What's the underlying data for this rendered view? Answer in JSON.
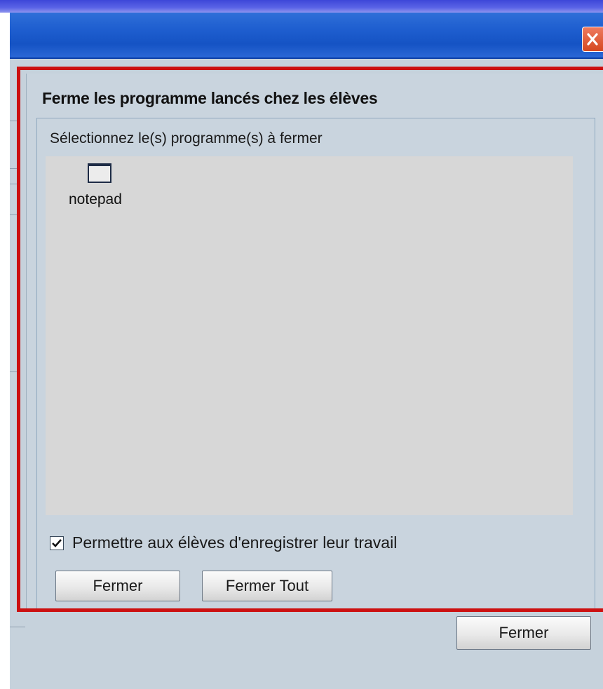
{
  "window": {
    "close_icon": "close-x-icon"
  },
  "panel": {
    "title": "Ferme les programme lancés chez les élèves",
    "group_label": "Sélectionnez le(s) programme(s) à fermer",
    "programs": [
      {
        "name": "notepad",
        "icon": "program-window-icon"
      }
    ],
    "allow_save_checkbox": {
      "label": "Permettre aux élèves d'enregistrer leur travail",
      "checked": true
    },
    "buttons": {
      "close_label": "Fermer",
      "close_all_label": "Fermer Tout"
    }
  },
  "footer": {
    "close_label": "Fermer"
  },
  "colors": {
    "highlight": "#cc1111",
    "titlebar": "#1f5fd0",
    "window_bg": "#c9d4de",
    "listbox_bg": "#d7d7d7"
  }
}
